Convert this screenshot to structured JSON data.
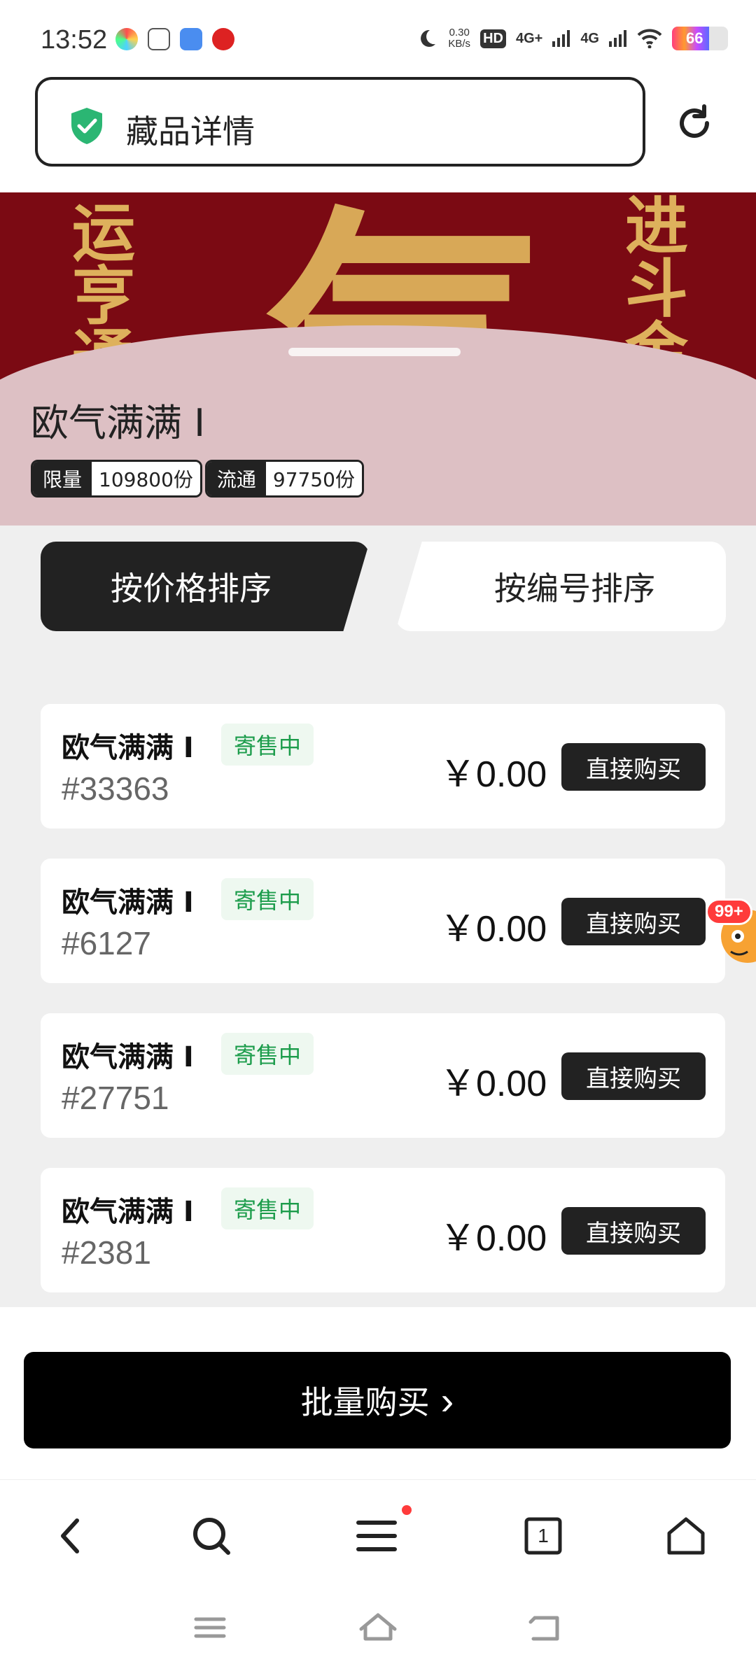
{
  "status_bar": {
    "time": "13:52",
    "net_speed_value": "0.30",
    "net_speed_unit": "KB/s",
    "hd_label": "HD",
    "sim1": "4G+",
    "sim2": "4G",
    "battery": "66"
  },
  "url_bar": {
    "title": "藏品详情",
    "secure_icon": "shield-check-icon",
    "reload_icon": "reload-icon"
  },
  "banner": {
    "item_title": "欧气满满 Ⅰ",
    "tags": [
      {
        "key": "限量",
        "value": "109800份"
      },
      {
        "key": "流通",
        "value": "97750份"
      }
    ]
  },
  "sort_tabs": {
    "by_price": "按价格排序",
    "by_number": "按编号排序"
  },
  "listings": [
    {
      "name": "欧气满满 Ⅰ",
      "status": "寄售中",
      "serial": "#33363",
      "price": "￥0.00",
      "action": "直接购买"
    },
    {
      "name": "欧气满满 Ⅰ",
      "status": "寄售中",
      "serial": "#6127",
      "price": "￥0.00",
      "action": "直接购买"
    },
    {
      "name": "欧气满满 Ⅰ",
      "status": "寄售中",
      "serial": "#27751",
      "price": "￥0.00",
      "action": "直接购买"
    },
    {
      "name": "欧气满满 Ⅰ",
      "status": "寄售中",
      "serial": "#2381",
      "price": "￥0.00",
      "action": "直接购买"
    }
  ],
  "floating_badge": "99+",
  "bulk_buy": {
    "label": "批量购买",
    "chevron": "›"
  },
  "browser_nav": {
    "tab_count": "1"
  },
  "colors": {
    "banner_red": "#7b0a13",
    "banner_pink": "#ddc0c4",
    "status_green": "#1c9c4b",
    "dark": "#222222"
  }
}
